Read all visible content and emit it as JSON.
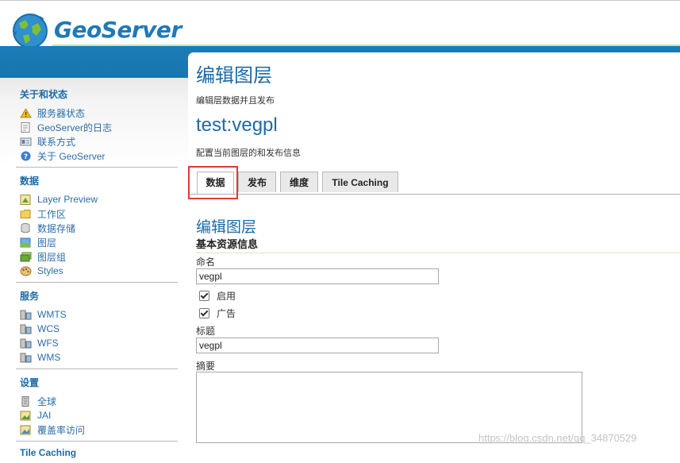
{
  "app": {
    "logo_text": "GeoServer"
  },
  "sidebar": {
    "sections": [
      {
        "title": "关于和状态",
        "items": [
          {
            "label": "服务器状态",
            "icon": "server-status-icon"
          },
          {
            "label": "GeoServer的日志",
            "icon": "log-icon"
          },
          {
            "label": "联系方式",
            "icon": "contact-icon"
          },
          {
            "label": "关于 GeoServer",
            "icon": "about-icon"
          }
        ]
      },
      {
        "title": "数据",
        "items": [
          {
            "label": "Layer Preview",
            "icon": "layer-preview-icon"
          },
          {
            "label": "工作区",
            "icon": "folder-icon"
          },
          {
            "label": "数据存储",
            "icon": "store-icon"
          },
          {
            "label": "图层",
            "icon": "layer-icon"
          },
          {
            "label": "图层组",
            "icon": "layer-group-icon"
          },
          {
            "label": "Styles",
            "icon": "styles-icon"
          }
        ]
      },
      {
        "title": "服务",
        "items": [
          {
            "label": "WMTS",
            "icon": "service-icon"
          },
          {
            "label": "WCS",
            "icon": "service-icon"
          },
          {
            "label": "WFS",
            "icon": "service-icon"
          },
          {
            "label": "WMS",
            "icon": "service-icon"
          }
        ]
      },
      {
        "title": "设置",
        "items": [
          {
            "label": "全球",
            "icon": "global-settings-icon"
          },
          {
            "label": "JAI",
            "icon": "jai-icon"
          },
          {
            "label": "覆盖率访问",
            "icon": "coverage-access-icon"
          }
        ]
      },
      {
        "title": "Tile Caching",
        "items": []
      }
    ]
  },
  "main": {
    "title": "编辑图层",
    "subtitle": "编辑层数据并且发布",
    "layer_name": "test:vegpl",
    "layer_desc": "配置当前图层的和发布信息",
    "tabs": [
      {
        "label": "数据",
        "active": true
      },
      {
        "label": "发布",
        "active": false
      },
      {
        "label": "维度",
        "active": false
      },
      {
        "label": "Tile Caching",
        "active": false
      }
    ],
    "section_title": "编辑图层",
    "basic_info": "基本资源信息",
    "name_label": "命名",
    "name_value": "vegpl",
    "enabled_label": "启用",
    "enabled_checked": true,
    "advertised_label": "广告",
    "advertised_checked": true,
    "title_label": "标题",
    "title_value": "vegpl",
    "abstract_label": "摘要",
    "abstract_value": ""
  },
  "watermark": "https://blog.csdn.net/qq_34870529",
  "colors": {
    "brand_blue": "#1c6aa5",
    "band": "#1a7cb7",
    "highlight_red": "#e53935"
  }
}
